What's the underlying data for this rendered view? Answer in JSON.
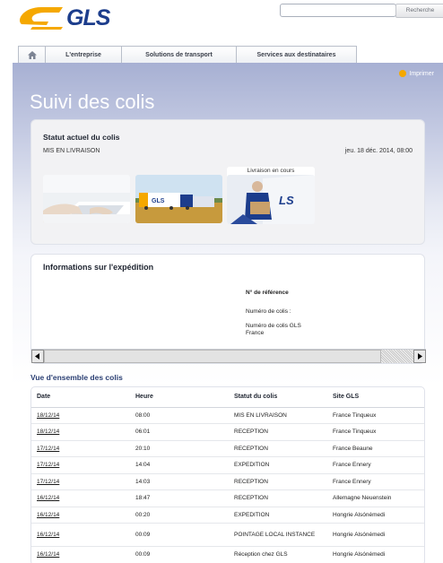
{
  "header": {
    "logo_text": "GLS",
    "search_placeholder": "",
    "search_button_label": "Recherche"
  },
  "nav": {
    "home_icon": "home-icon",
    "tabs": [
      "L'entreprise",
      "Solutions de transport",
      "Services aux destinataires"
    ]
  },
  "main": {
    "print_label": "Imprimer",
    "page_title": "Suivi des colis"
  },
  "status": {
    "heading": "Statut actuel du colis",
    "value": "MIS EN LIVRAISON",
    "date": "jeu. 18 déc. 2014, 08:00",
    "current_step_label": "Livraison en cours"
  },
  "shipment_info": {
    "heading": "Informations sur l'expédition",
    "reference_label": "N° de référence",
    "parcel_count_label": "Numéro de colis :",
    "gls_parcel_label": "Numéro de colis GLS France"
  },
  "overview": {
    "heading": "Vue d'ensemble des colis",
    "columns": [
      "Date",
      "Heure",
      "Statut du colis",
      "Site GLS"
    ],
    "rows": [
      {
        "date": "18/12/14",
        "time": "08:00",
        "status": "MIS EN LIVRAISON",
        "site": "France Tinqueux"
      },
      {
        "date": "18/12/14",
        "time": "06:01",
        "status": "RECEPTION",
        "site": "France Tinqueux"
      },
      {
        "date": "17/12/14",
        "time": "20:10",
        "status": "RECEPTION",
        "site": "France Beaune"
      },
      {
        "date": "17/12/14",
        "time": "14:04",
        "status": "EXPEDITION",
        "site": "France Ennery"
      },
      {
        "date": "17/12/14",
        "time": "14:03",
        "status": "RECEPTION",
        "site": "France Ennery"
      },
      {
        "date": "16/12/14",
        "time": "18:47",
        "status": "RECEPTION",
        "site": "Allemagne Neuenstein"
      },
      {
        "date": "16/12/14",
        "time": "00:20",
        "status": "EXPEDITION",
        "site": "Hongrie Alsónémedi"
      },
      {
        "date": "16/12/14",
        "time": "00:09",
        "status": "POINTAGE LOCAL INSTANCE",
        "site": "Hongrie Alsónémedi"
      },
      {
        "date": "16/12/14",
        "time": "00:09",
        "status": "Réception chez GLS",
        "site": "Hongrie Alsónémedi"
      }
    ]
  },
  "colors": {
    "brand_blue": "#1c3d8c",
    "brand_yellow": "#f5a800",
    "heading_blue": "#2b3f73"
  }
}
